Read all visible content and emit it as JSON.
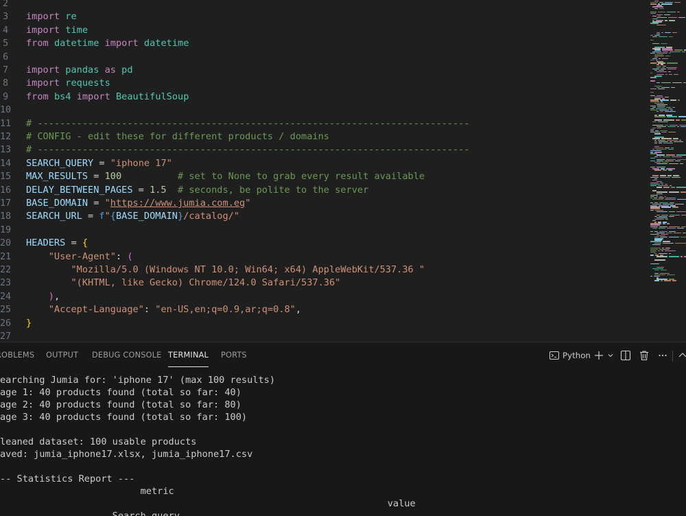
{
  "editor": {
    "line_numbers": [
      "2",
      "3",
      "4",
      "5",
      "6",
      "7",
      "8",
      "9",
      "10",
      "11",
      "12",
      "13",
      "14",
      "15",
      "16",
      "17",
      "18",
      "19",
      "20",
      "21",
      "22",
      "23",
      "24",
      "25",
      "26",
      "27"
    ],
    "code": {
      "l3_kw": "import",
      "l3_mod": "re",
      "l4_kw": "import",
      "l4_mod": "time",
      "l5_kw1": "from",
      "l5_mod1": "datetime",
      "l5_kw2": "import",
      "l5_mod2": "datetime",
      "l7_kw1": "import",
      "l7_mod": "pandas",
      "l7_kw2": "as",
      "l7_alias": "pd",
      "l8_kw": "import",
      "l8_mod": "requests",
      "l9_kw1": "from",
      "l9_mod": "bs4",
      "l9_kw2": "import",
      "l9_cls": "BeautifulSoup",
      "l11": "# -----------------------------------------------------------------------------",
      "l12": "# CONFIG - edit these for different products / domains",
      "l13": "# -----------------------------------------------------------------------------",
      "l14_var": "SEARCH_QUERY",
      "l14_op": " = ",
      "l14_str": "\"iphone 17\"",
      "l15_var": "MAX_RESULTS",
      "l15_op": " = ",
      "l15_num": "100",
      "l15_com": "          # set to None to grab every result available",
      "l16_var": "DELAY_BETWEEN_PAGES",
      "l16_op": " = ",
      "l16_num": "1.5",
      "l16_com": "  # seconds, be polite to the server",
      "l17_var": "BASE_DOMAIN",
      "l17_op": " = ",
      "l17_q1": "\"",
      "l17_url": "https://www.jumia.com.eg",
      "l17_q2": "\"",
      "l18_var": "SEARCH_URL",
      "l18_op": " = ",
      "l18_f": "f",
      "l18_q1": "\"",
      "l18_b1": "{",
      "l18_sub": "BASE_DOMAIN",
      "l18_b2": "}",
      "l18_rest": "/catalog/\"",
      "l20_var": "HEADERS",
      "l20_op": " = ",
      "l20_br": "{",
      "l21_key": "\"User-Agent\"",
      "l21_op": ": ",
      "l21_br": "(",
      "l22_str": "\"Mozilla/5.0 (Windows NT 10.0; Win64; x64) AppleWebKit/537.36 \"",
      "l23_str": "\"(KHTML, like Gecko) Chrome/124.0 Safari/537.36\"",
      "l24_br": ")",
      "l24_op": ",",
      "l25_key": "\"Accept-Language\"",
      "l25_op": ": ",
      "l25_str": "\"en-US,en;q=0.9,ar;q=0.8\"",
      "l25_op2": ",",
      "l26_br": "}"
    }
  },
  "panel": {
    "tabs": [
      "ROBLEMS",
      "OUTPUT",
      "DEBUG CONSOLE",
      "TERMINAL",
      "PORTS"
    ],
    "active_tab": "TERMINAL",
    "terminal_profile": "Python",
    "icons": [
      "terminal-icon",
      "plus-icon",
      "chevron-down-icon",
      "split-icon",
      "trash-icon",
      "ellipsis-icon"
    ]
  },
  "terminal": {
    "lines": [
      "earching Jumia for: 'iphone 17' (max 100 results)",
      "age 1: 40 products found (total so far: 40)",
      "age 2: 40 products found (total so far: 80)",
      "age 3: 40 products found (total so far: 100)",
      "",
      "leaned dataset: 100 usable products",
      "aved: jumia_iphone17.xlsx, jumia_iphone17.csv",
      "",
      "-- Statistics Report ---",
      "                         metric",
      "                                                                     value",
      "                    Search query"
    ]
  },
  "colors": {
    "editor_bg": "#1f1f1f",
    "panel_bg": "#181818",
    "keyword": "#c586c0",
    "module": "#4ec9b0",
    "variable": "#9cdcfe",
    "comment": "#6a9955",
    "string": "#ce9178",
    "number": "#b5cea8"
  }
}
